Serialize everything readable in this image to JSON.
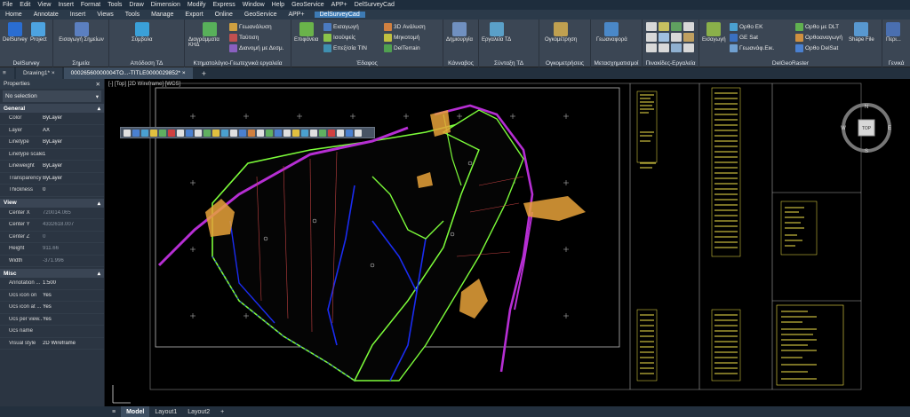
{
  "menubar": [
    "File",
    "Edit",
    "View",
    "Insert",
    "Format",
    "Tools",
    "Draw",
    "Dimension",
    "Modify",
    "Express",
    "Window",
    "Help",
    "GeoService",
    "APP+",
    "DelSurveyCad"
  ],
  "ribbon_tabs": [
    "Home",
    "Annotate",
    "Insert",
    "Views",
    "Tools",
    "Manage",
    "Export",
    "Online",
    "GeoService",
    "APP+",
    "DelSurveyCad"
  ],
  "ribbon_active_tab": "DelSurveyCad",
  "ribbon": {
    "g1": {
      "label": "DelSurvey",
      "b1": "DelSurvey",
      "b2": "Project"
    },
    "g2": {
      "label": "Σημεία",
      "b1": "Εισαγωγή Σημείων"
    },
    "g3": {
      "label": "Απόδοση ΤΔ",
      "b1": "Σύμβολα"
    },
    "g4": {
      "label": "Κτηματολόγιο-Γεωτεχνικά εργαλεία",
      "b1": "Διαγράμματα ΚΗΔ",
      "r1": "Γεωανάλυση",
      "r2": "Ταύτιση",
      "r3": "Διανομή με Δεσμ."
    },
    "g5": {
      "label": "Έδαφος",
      "b1": "Επιφάνεια",
      "r1": "Εισαγωγή",
      "r2": "Ισοϋψείς",
      "r3": "Επεξ/σία TIN",
      "r4": "3D Ανάλυση",
      "r5": "Μηκοτομή",
      "r6": "DelTerrain"
    },
    "g6": {
      "label": "Κάνναβος",
      "b1": "Δημιουργία"
    },
    "g7": {
      "label": "Σύνταξη ΤΔ",
      "b1": "Εργαλεία ΤΔ"
    },
    "g8": {
      "label": "Ογκομετρήσεις",
      "b1": "Ογκομέτρηση"
    },
    "g9": {
      "label": "Μετασχηματισμοί",
      "b1": "Γεωαναφορά"
    },
    "g10": {
      "label": "Πινακίδες-Εργαλεία"
    },
    "g11": {
      "label": "DelGeoRaster",
      "b1": "Εισαγωγή",
      "r1": "Ορθο ΕΚ",
      "r2": "GE Sat",
      "r3": "Γεωανάφ.Εικ.",
      "r4": "Ορθο με DLT",
      "r5": "Ορθοαναγωγή",
      "r6": "Ορθο DelSat",
      "b2": "Shape File"
    },
    "g12": {
      "label": "Γενικά",
      "b1": "Περι..."
    }
  },
  "doc_tabs": [
    "Drawing1*",
    "00026560000004TO...-TITLE0000029852*"
  ],
  "properties": {
    "title": "Properties",
    "selection": "No selection",
    "general_label": "General",
    "general": [
      {
        "k": "Color",
        "v": "ByLayer"
      },
      {
        "k": "Layer",
        "v": "AX"
      },
      {
        "k": "Linetype",
        "v": "ByLayer"
      },
      {
        "k": "Linetype scale",
        "v": "1"
      },
      {
        "k": "Lineweight",
        "v": "ByLayer"
      },
      {
        "k": "Transparency",
        "v": "ByLayer"
      },
      {
        "k": "Thickness",
        "v": "0"
      }
    ],
    "view_label": "View",
    "view": [
      {
        "k": "Center X",
        "v": "720014.065"
      },
      {
        "k": "Center Y",
        "v": "4332618.007"
      },
      {
        "k": "Center Z",
        "v": "0"
      },
      {
        "k": "Height",
        "v": "911.66"
      },
      {
        "k": "Width",
        "v": "-371.996"
      }
    ],
    "misc_label": "Misc",
    "misc": [
      {
        "k": "Annotation ...",
        "v": "1:500"
      },
      {
        "k": "Ucs icon on",
        "v": "Yes"
      },
      {
        "k": "Ucs icon at ...",
        "v": "Yes"
      },
      {
        "k": "Ucs per view...",
        "v": "Yes"
      },
      {
        "k": "Ucs name",
        "v": ""
      },
      {
        "k": "Visual style",
        "v": "2D Wireframe"
      }
    ]
  },
  "viewport_label": "[-] [Top] [2D Wireframe] [WCS]",
  "viewcube": {
    "face": "TOP",
    "n": "N",
    "s": "S",
    "e": "E",
    "w": "W"
  },
  "layout_tabs": [
    "Model",
    "Layout1",
    "Layout2"
  ],
  "colors": {
    "accent": "#3d7bb5",
    "boundary_green": "#7cfc3a",
    "road_magenta": "#b62ed3",
    "parcel_blue": "#1a2cf2",
    "hatch_orange": "#e8a23a",
    "title_block_yellow": "#f4e54a"
  }
}
